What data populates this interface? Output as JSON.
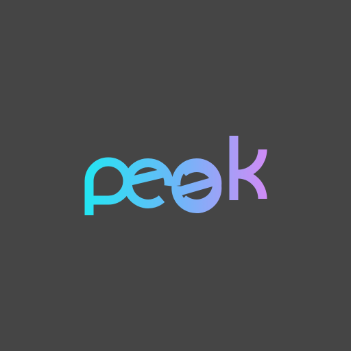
{
  "brand": {
    "wordmark": "peek",
    "colors": {
      "background": "#454545",
      "gradient_start": "#22E6F2",
      "gradient_mid": "#6BB8F8",
      "gradient_end": "#D08BF6"
    }
  }
}
